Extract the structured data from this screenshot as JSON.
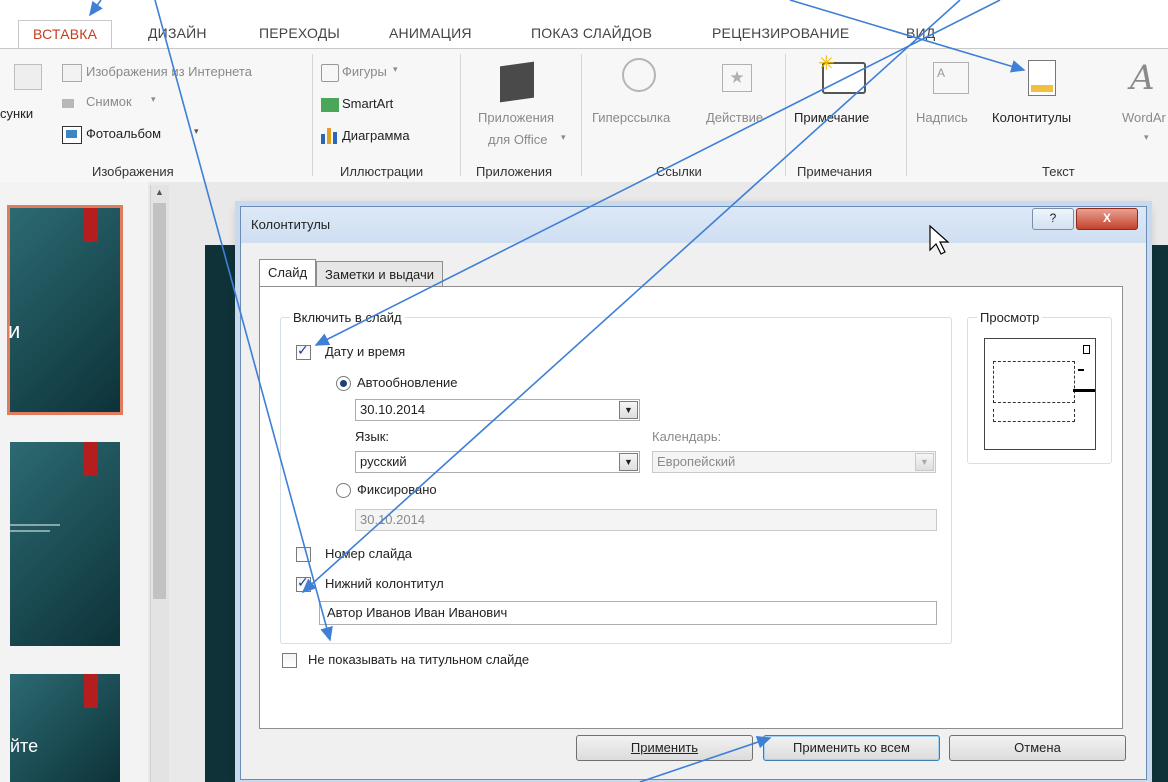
{
  "tabs": [
    "ВСТАВКА",
    "ДИЗАЙН",
    "ПЕРЕХОДЫ",
    "АНИМАЦИЯ",
    "ПОКАЗ СЛАЙДОВ",
    "РЕЦЕНЗИРОВАНИЕ",
    "ВИД"
  ],
  "ribbon": {
    "images": {
      "online": "Изображения из Интернета",
      "snapshot": "Снимок",
      "album": "Фотоальбом",
      "pictures_partial": "сунки",
      "label": "Изображения"
    },
    "illustrations": {
      "shapes": "Фигуры",
      "smartart": "SmartArt",
      "chart": "Диаграмма",
      "label": "Иллюстрации"
    },
    "apps": {
      "line1": "Приложения",
      "line2": "для Office",
      "label": "Приложения"
    },
    "links": {
      "hyperlink": "Гиперссылка",
      "action": "Действие",
      "label": "Ссылки"
    },
    "comments": {
      "comment": "Примечание",
      "label": "Примечания"
    },
    "text": {
      "textbox": "Надпись",
      "header_footer": "Колонтитулы",
      "wordart": "WordAr",
      "label": "Текст"
    }
  },
  "thumbnails": {
    "slide1_char": "и",
    "slide3_text": "йте"
  },
  "dialog": {
    "title": "Колонтитулы",
    "help_glyph": "?",
    "close_glyph": "X",
    "tabs": {
      "slide": "Слайд",
      "notes": "Заметки и выдачи"
    },
    "include_group": "Включить в слайд",
    "date_time": "Дату и время",
    "date_checked": true,
    "auto_update": "Автообновление",
    "auto_date": "30.10.2014",
    "language_label": "Язык:",
    "language": "русский",
    "calendar_label": "Календарь:",
    "calendar": "Европейский",
    "fixed": "Фиксировано",
    "fixed_date": "30.10.2014",
    "slide_number": "Номер слайда",
    "slide_number_checked": false,
    "footer": "Нижний колонтитул",
    "footer_checked": true,
    "footer_text": "Автор Иванов Иван Иванович",
    "dont_show_title": "Не показывать на титульном слайде",
    "dont_show_checked": false,
    "preview_label": "Просмотр",
    "apply": "Применить",
    "apply_all": "Применить ко всем",
    "cancel": "Отмена"
  },
  "colors": {
    "accent": "#c43e1c",
    "arrow": "#3f7fd6",
    "slide_bg": "#0f3238",
    "title_red": "#b51e1e"
  }
}
